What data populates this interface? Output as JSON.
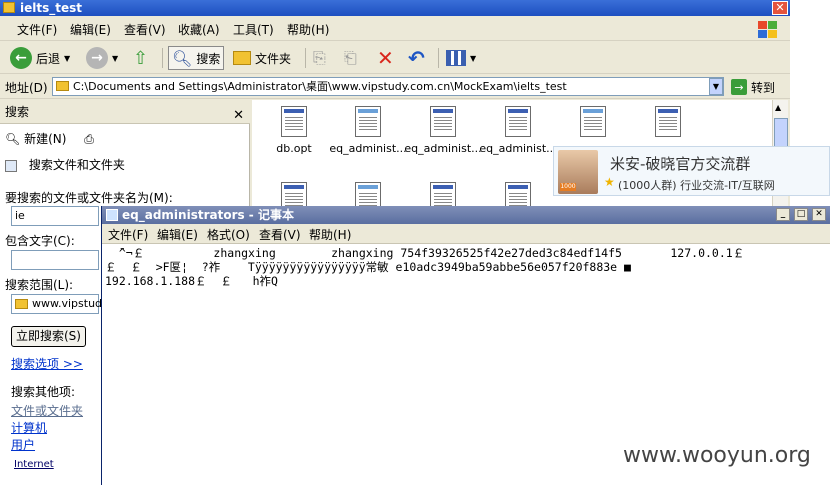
{
  "explorer": {
    "title": "ielts_test",
    "menu": [
      "文件(F)",
      "编辑(E)",
      "查看(V)",
      "收藏(A)",
      "工具(T)",
      "帮助(H)"
    ],
    "toolbar": {
      "back": "后退",
      "search": "搜索",
      "folders": "文件夹"
    },
    "address": {
      "label": "地址(D)",
      "path": "C:\\Documents and Settings\\Administrator\\桌面\\www.vipstudy.com.cn\\MockExam\\ielts_test",
      "go": "转到"
    }
  },
  "search_pane": {
    "title": "搜索",
    "new_label": "新建(N)",
    "find_files_label": "搜索文件和文件夹",
    "name_label": "要搜索的文件或文件夹名为(M):",
    "name_value": "ie",
    "content_label": "包含文字(C):",
    "content_value": "",
    "scope_label": "搜索范围(L):",
    "scope_value": "www.vipstudy",
    "search_now": "立即搜索(S)",
    "search_options": "搜索选项 >>",
    "other_label": "搜索其他项:",
    "other_items": [
      "文件或文件夹",
      "计算机",
      "用户"
    ],
    "internet": "Internet"
  },
  "files": [
    {
      "name": "db.opt",
      "type": "file"
    },
    {
      "name": "eq_administ...",
      "type": "doc"
    },
    {
      "name": "eq_administ...",
      "type": "file"
    },
    {
      "name": "eq_administ...",
      "type": "file"
    }
  ],
  "qq_popup": {
    "title": "米安-破晓官方交流群",
    "subtitle": "(1000人群) 行业交流-IT/互联网",
    "badge": "1000"
  },
  "notepad": {
    "title": "eq_administrators - 记事本",
    "menu": [
      "文件(F)",
      "编辑(E)",
      "格式(O)",
      "查看(V)",
      "帮助(H)"
    ],
    "content": "  ̄^¬￡          zhangxing        zhangxing 754f39326525f42e27ded3c84edf14f5       127.0.0.1￡\n￡  ￡  >F匽¦  ?祚    Tÿÿÿÿÿÿÿÿÿÿÿÿÿÿÿÿ常敏 e10adc3949ba59abbe56e057f20f883e ■\n192.168.1.188￡  ￡   h祚Q"
  },
  "watermark": "www.wooyun.org"
}
